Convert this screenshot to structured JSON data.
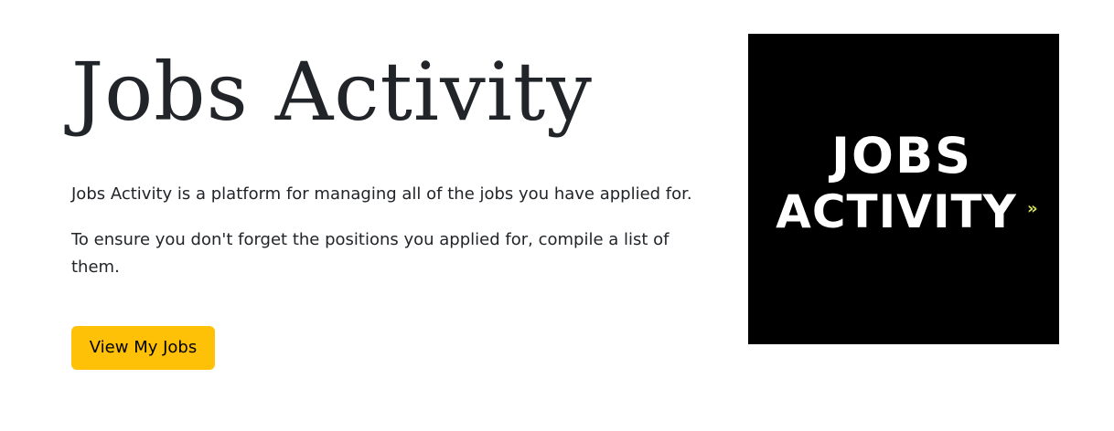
{
  "hero": {
    "title": "Jobs Activity",
    "paragraphs": [
      "Jobs Activity is a platform for managing all of the jobs you have applied for.",
      "To ensure you don't forget the positions you applied for, compile a list of them."
    ],
    "cta_label": "View My Jobs"
  },
  "logo": {
    "line1": "JOBS",
    "line2": "ACTIVITY",
    "arrow_glyph": "»",
    "background_color": "#000000",
    "text_color": "#ffffff",
    "accent_color": "#d4e157"
  },
  "colors": {
    "button": "#ffc107",
    "text": "#212529"
  }
}
